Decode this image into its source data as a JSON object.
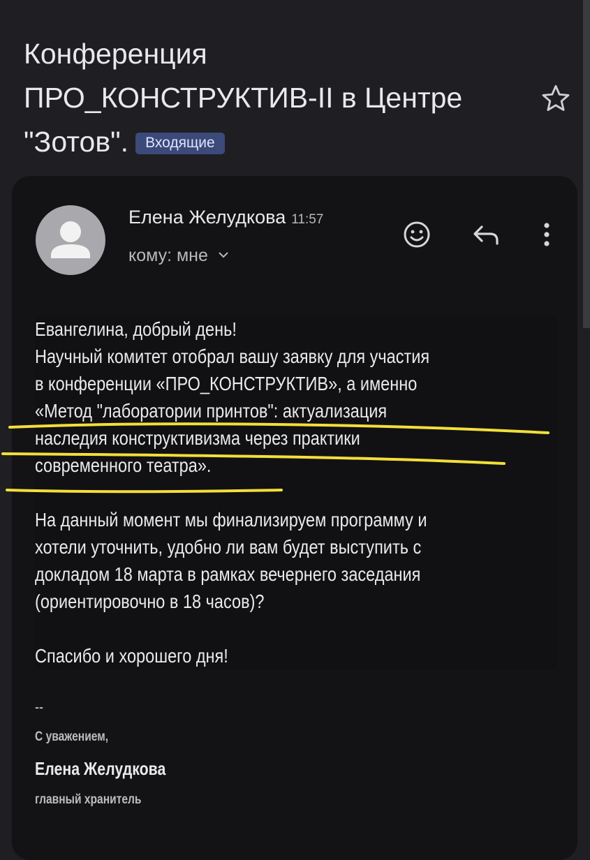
{
  "subject": {
    "lines": [
      "Конференция",
      "ПРО_КОНСТРУКТИВ-II в Центре",
      "\"Зотов\"."
    ],
    "label": "Входящие"
  },
  "message": {
    "sender_name": "Елена Желудкова",
    "time": "11:57",
    "recipient": "кому: мне"
  },
  "body": {
    "lines": [
      "Евангелина, добрый день!",
      "Научный комитет отобрал вашу заявку для участия",
      "в конференции «ПРО_КОНСТРУКТИВ», а именно",
      "«Метод \"лаборатории принтов\": актуализация",
      "наследия конструктивизма через практики",
      "современного театра».",
      "",
      "На данный момент мы финализируем программу и",
      "хотели уточнить, удобно ли вам будет выступить с",
      "докладом 18 марта в рамках вечернего заседания",
      "(ориентировочно в 18 часов)?",
      "",
      "Спасибо и хорошего дня!"
    ]
  },
  "signature": {
    "dash": "--",
    "regards": "С уважением,",
    "name": "Елена Желудкова",
    "role": "главный хранитель"
  },
  "icons": {
    "star": "star-outline-icon",
    "emoji": "emoji-react-icon",
    "reply": "reply-icon",
    "more": "more-vert-icon",
    "chevron": "chevron-down-icon"
  },
  "colors": {
    "background": "#1f1f23",
    "card": "#131316",
    "label_chip": "#3c4a7a",
    "highlight": "#f2df3a"
  }
}
